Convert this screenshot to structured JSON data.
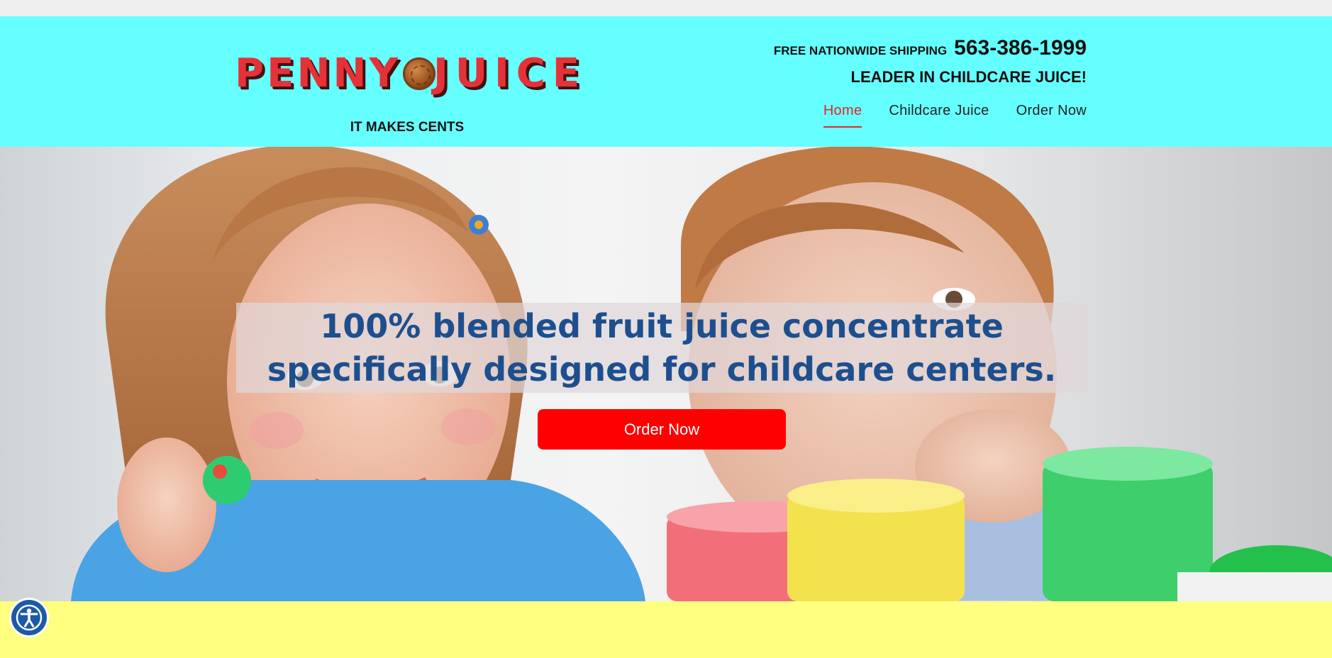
{
  "brand": {
    "logo_word_1": [
      "P",
      "E",
      "N",
      "N",
      "Y"
    ],
    "logo_word_2": [
      "J",
      "U",
      "I",
      "C",
      "E"
    ],
    "tagline": "IT MAKES CENTS",
    "logo_color": "#e53238"
  },
  "header": {
    "background_color": "#66ffff",
    "shipping": "FREE NATIONWIDE SHIPPING",
    "phone": "563-386-1999",
    "leader": "LEADER IN CHILDCARE JUICE!"
  },
  "nav": {
    "items": [
      {
        "label": "Home",
        "active": true
      },
      {
        "label": "Childcare Juice",
        "active": false
      },
      {
        "label": "Order Now",
        "active": false
      }
    ],
    "active_color": "#e0272c"
  },
  "hero": {
    "headline": "100% blended fruit juice concentrate specifically designed for childcare centers.",
    "headline_color": "#1d4f8e",
    "button_label": "Order Now",
    "button_color": "#ff0000"
  },
  "footer_band": {
    "color": "#ffff80"
  },
  "accessibility": {
    "icon": "accessibility-icon",
    "color": "#1c5aa6"
  }
}
